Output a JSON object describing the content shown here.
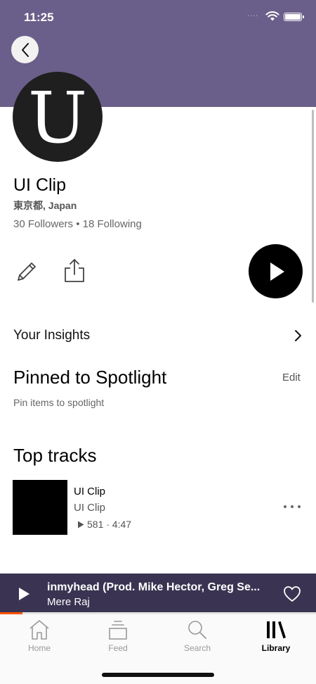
{
  "status_bar": {
    "time": "11:25",
    "signal": "...."
  },
  "profile": {
    "avatar_letter": "U",
    "name": "UI Clip",
    "location": "東京都, Japan",
    "followers_text": "30 Followers • 18 Following"
  },
  "insights": {
    "label": "Your Insights"
  },
  "spotlight": {
    "title": "Pinned to Spotlight",
    "edit_label": "Edit",
    "subtitle": "Pin items to spotlight"
  },
  "top_tracks": {
    "title": "Top tracks",
    "items": [
      {
        "title": "UI Clip",
        "artist": "UI Clip",
        "stats": "581 · 4:47"
      }
    ]
  },
  "mini_player": {
    "title": "inmyhead (Prod. Mike Hector, Greg Se...",
    "artist": "Mere Raj",
    "progress": 0.07
  },
  "tab_bar": {
    "items": [
      {
        "label": "Home",
        "icon": "home-icon",
        "active": false
      },
      {
        "label": "Feed",
        "icon": "feed-icon",
        "active": false
      },
      {
        "label": "Search",
        "icon": "search-icon",
        "active": false
      },
      {
        "label": "Library",
        "icon": "library-icon",
        "active": true
      }
    ]
  },
  "colors": {
    "header": "#6a5f8a",
    "mini_player": "#3a3452",
    "accent": "#ff5500"
  }
}
